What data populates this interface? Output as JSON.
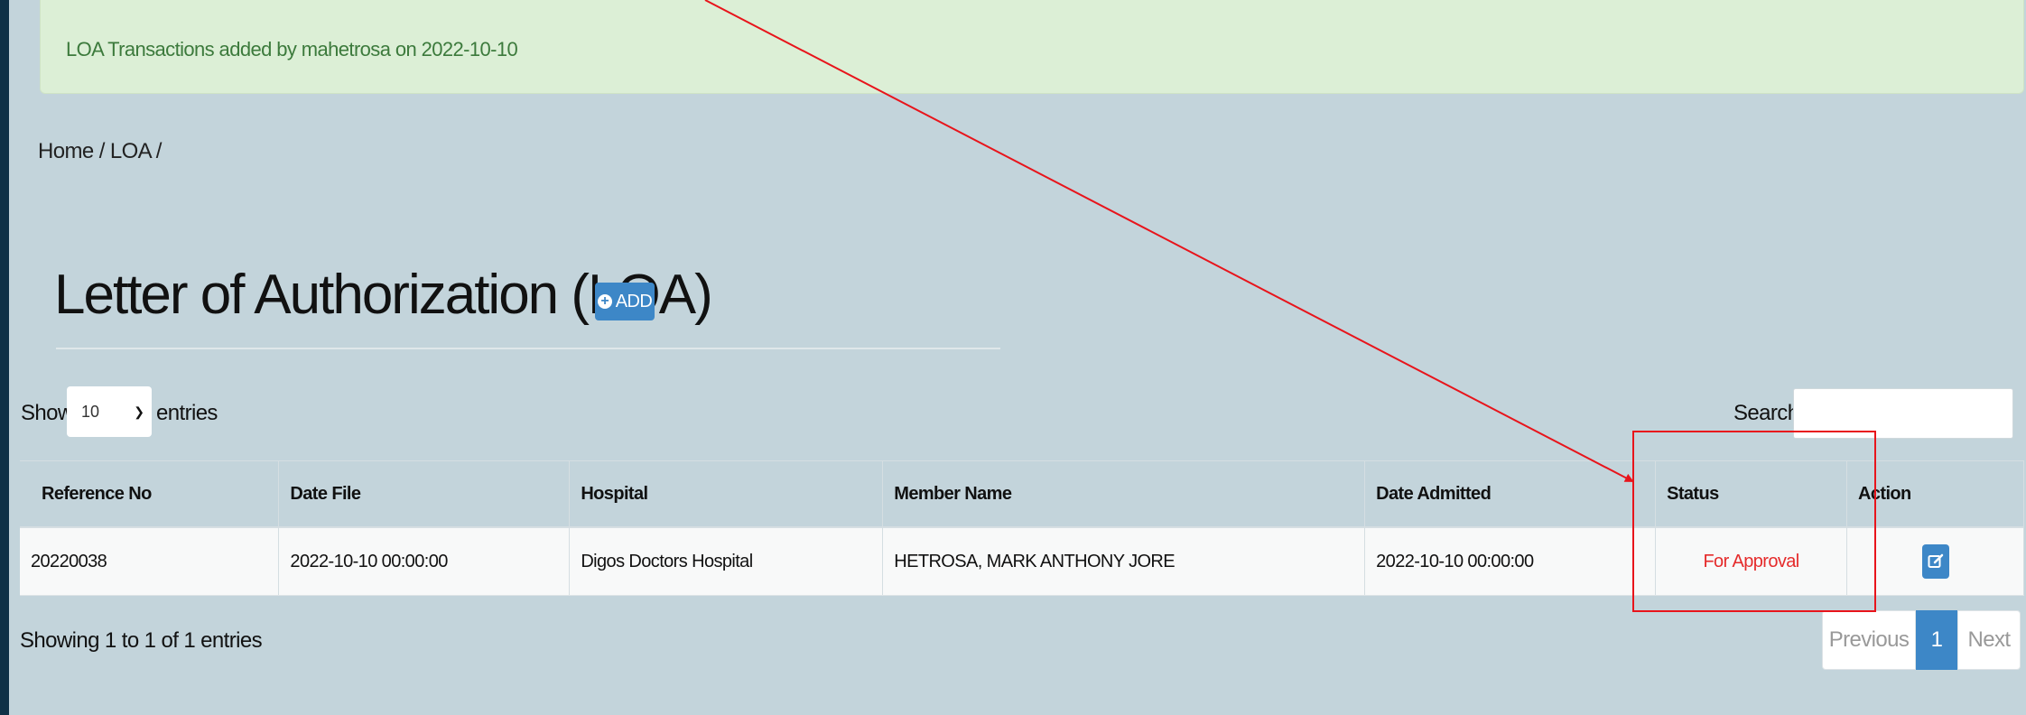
{
  "alert": {
    "text": "LOA Transactions added by mahetrosa on 2022-10-10"
  },
  "breadcrumb": "Home / LOA /",
  "page_title": "Letter of Authorization (LOA)",
  "add_button": {
    "label": "ADD",
    "icon": "plus-circle-icon"
  },
  "length": {
    "show_label": "Show",
    "value": "10",
    "entries_label": "entries"
  },
  "search": {
    "label": "Search:",
    "value": ""
  },
  "table": {
    "columns": [
      "Reference No",
      "Date File",
      "Hospital",
      "Member Name",
      "Date Admitted",
      "Status",
      "Action"
    ],
    "rows": [
      {
        "reference_no": "20220038",
        "date_file": "2022-10-10 00:00:00",
        "hospital": "Digos Doctors Hospital",
        "member_name": "HETROSA, MARK ANTHONY JORE",
        "date_admitted": "2022-10-10 00:00:00",
        "status": "For Approval",
        "action_icon": "edit-icon"
      }
    ]
  },
  "info": "Showing 1 to 1 of 1 entries",
  "pagination": {
    "previous": "Previous",
    "current": "1",
    "next": "Next"
  },
  "colors": {
    "primary": "#3d87c7",
    "status_pending": "#e52b2b",
    "annotation": "#e8141b",
    "page_bg": "#c3d4db"
  }
}
